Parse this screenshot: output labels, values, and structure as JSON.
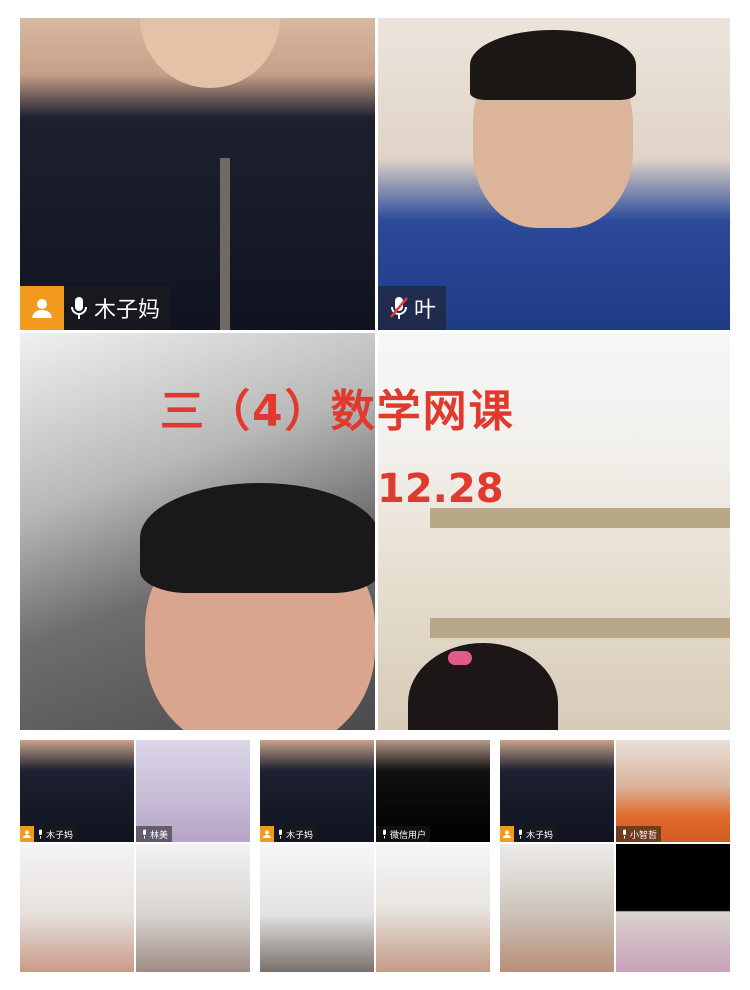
{
  "overlay": {
    "title": "三（4）数学网课",
    "date": "12.28"
  },
  "main_grid": [
    {
      "name": "木子妈",
      "is_host": true,
      "mic": "on"
    },
    {
      "name": "叶",
      "is_host": false,
      "mic": "muted"
    },
    {
      "name": "",
      "is_host": false,
      "mic": "none"
    },
    {
      "name": "",
      "is_host": false,
      "mic": "none"
    }
  ],
  "thumbnails": [
    {
      "tiles": [
        {
          "name": "木子妈",
          "is_host": true
        },
        {
          "name": "林美",
          "is_host": false
        },
        {
          "name": "",
          "is_host": false
        },
        {
          "name": "",
          "is_host": false
        }
      ]
    },
    {
      "tiles": [
        {
          "name": "木子妈",
          "is_host": true
        },
        {
          "name": "微信用户",
          "is_host": false
        },
        {
          "name": "",
          "is_host": false
        },
        {
          "name": "",
          "is_host": false
        }
      ]
    },
    {
      "tiles": [
        {
          "name": "木子妈",
          "is_host": true
        },
        {
          "name": "小智哲",
          "is_host": false
        },
        {
          "name": "",
          "is_host": false
        },
        {
          "name": "",
          "is_host": false
        }
      ]
    }
  ],
  "colors": {
    "host_badge": "#f39a1e",
    "overlay_text": "#e03a2f"
  },
  "icons": [
    "person-icon",
    "microphone-icon",
    "microphone-muted-icon"
  ]
}
